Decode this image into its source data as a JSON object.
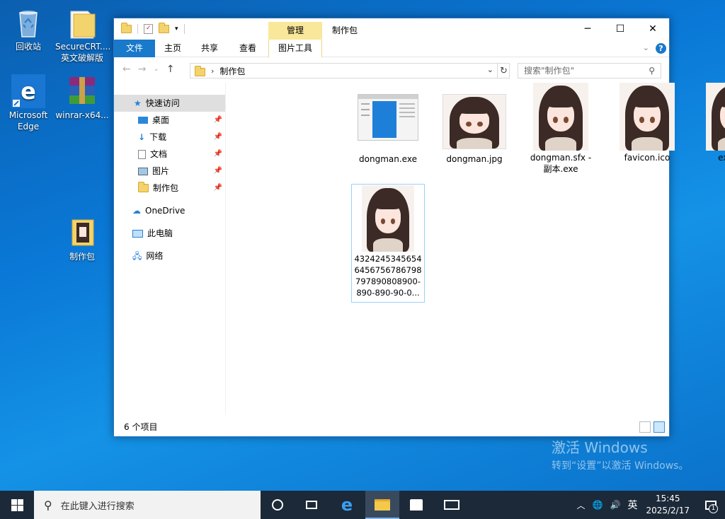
{
  "desktop": {
    "icons": [
      {
        "label": "回收站"
      },
      {
        "label": "SecureCRT....\n英文破解版"
      },
      {
        "label": "Microsoft\nEdge"
      },
      {
        "label": "winrar-x64..."
      },
      {
        "label": "制作包"
      }
    ],
    "watermark_title": "激活 Windows",
    "watermark_sub": "转到“设置”以激活 Windows。"
  },
  "window": {
    "manage_tab": "管理",
    "title": "制作包",
    "ribbon_tabs": [
      "文件",
      "主页",
      "共享",
      "查看",
      "图片工具"
    ],
    "address": "制作包",
    "search_placeholder": "搜索\"制作包\"",
    "nav": {
      "quick_access": "快速访问",
      "pinned": [
        "桌面",
        "下载",
        "文档",
        "图片",
        "制作包"
      ],
      "onedrive": "OneDrive",
      "this_pc": "此电脑",
      "network": "网络"
    },
    "files": [
      {
        "name": "dongman.exe"
      },
      {
        "name": "dongman.jpg"
      },
      {
        "name": "dongman.sfx -\n副本.exe"
      },
      {
        "name": "favicon.ico"
      },
      {
        "name": "exe.jpg"
      },
      {
        "name": "4324245345654\n6456756786798\n797890808900-\n890-890-90-0..."
      }
    ],
    "status": "6 个项目"
  },
  "taskbar": {
    "search_placeholder": "在此键入进行搜索",
    "ime": "英",
    "time": "15:45",
    "date": "2025/2/17",
    "notification_count": "1"
  }
}
